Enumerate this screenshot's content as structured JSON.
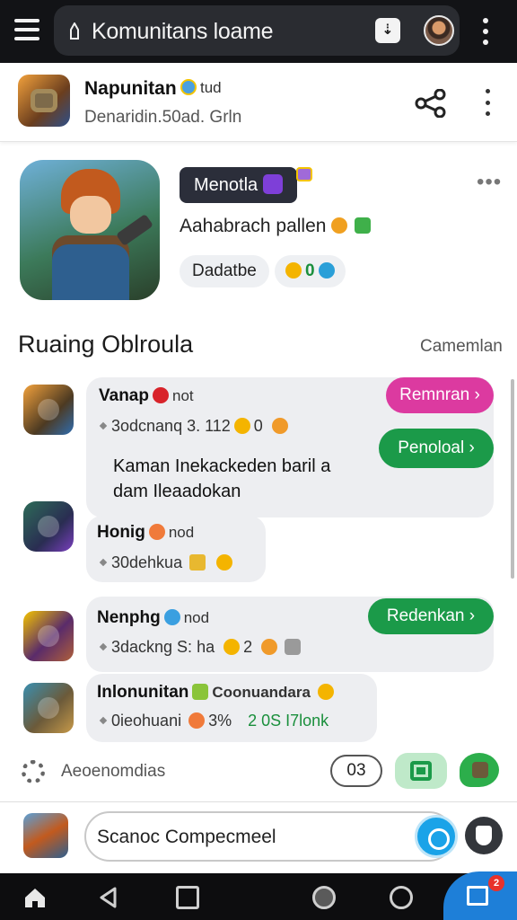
{
  "browser": {
    "url": "Komunitans loame",
    "tab_icon": "⇣"
  },
  "header": {
    "name": "Napunitan",
    "badge": "tud",
    "subtitle": "Denaridin.50ad. Grln"
  },
  "featured": {
    "tag": "Menotla",
    "description": "Aahabrach pallen",
    "pill_a": "Dadatbe",
    "pill_b_count": "0"
  },
  "section": {
    "title": "Ruaing Oblroula",
    "link": "Camemlan"
  },
  "items": [
    {
      "name": "Vanap",
      "tag": "not",
      "meta": "3odcnanq 3. 112",
      "meta_num": "0",
      "message": "Kaman Inekackeden baril a dam Ileaadokan",
      "button1": "Remnran",
      "button2": "Penoloal"
    },
    {
      "name": "Honig",
      "tag": "nod",
      "meta": "30dehkua"
    },
    {
      "name": "Nenphg",
      "tag": "nod",
      "meta": "3dackng S: ha",
      "meta_num": "2",
      "button": "Redenkan"
    },
    {
      "name": "Inlonunitan",
      "tag": "Coonuandara",
      "meta": "0ieohuani",
      "meta_pct": "3%",
      "meta_green": "2 0S I7lonk"
    }
  ],
  "hint": {
    "text": "Aeoenomdias",
    "chip": "03"
  },
  "composer": {
    "placeholder": "Scanoc Compecmeel"
  },
  "navbar": {
    "badge": "2"
  },
  "colors": {
    "accent_green": "#1b9a49",
    "accent_pink": "#dc3aa0",
    "accent_blue": "#1aa3e8",
    "topbar_bg": "#121316"
  },
  "icons": [
    "menu-icon",
    "lock-icon",
    "tab-icon",
    "profile-icon",
    "more-icon",
    "share-icon",
    "gear-icon",
    "chat-icon",
    "send-icon",
    "shield-icon",
    "home-icon",
    "back-icon",
    "gallery-icon",
    "game-icon",
    "clock-icon",
    "recent-apps-icon"
  ]
}
